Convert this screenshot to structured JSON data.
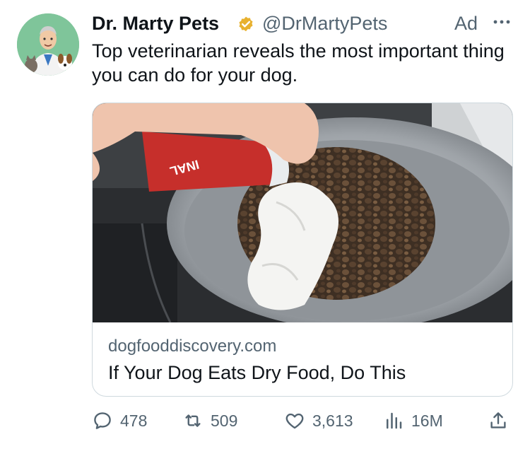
{
  "tweet": {
    "author_name": "Dr. Marty Pets",
    "handle": "@DrMartyPets",
    "ad_label": "Ad",
    "text": "Top veterinarian reveals the most important thing you can do for your dog.",
    "more_icon": "more-horizontal-icon",
    "verified_icon": "verified-badge-icon"
  },
  "card": {
    "domain": "dogfooddiscovery.com",
    "title": "If Your Dog Eats Dry Food, Do This",
    "image_can_text": "INAL"
  },
  "actions": {
    "replies": "478",
    "reposts": "509",
    "likes": "3,613",
    "views": "16M"
  },
  "colors": {
    "text": "#0f1419",
    "muted": "#536471",
    "badge": "#e8b12f",
    "card_border": "#cfd9de"
  }
}
